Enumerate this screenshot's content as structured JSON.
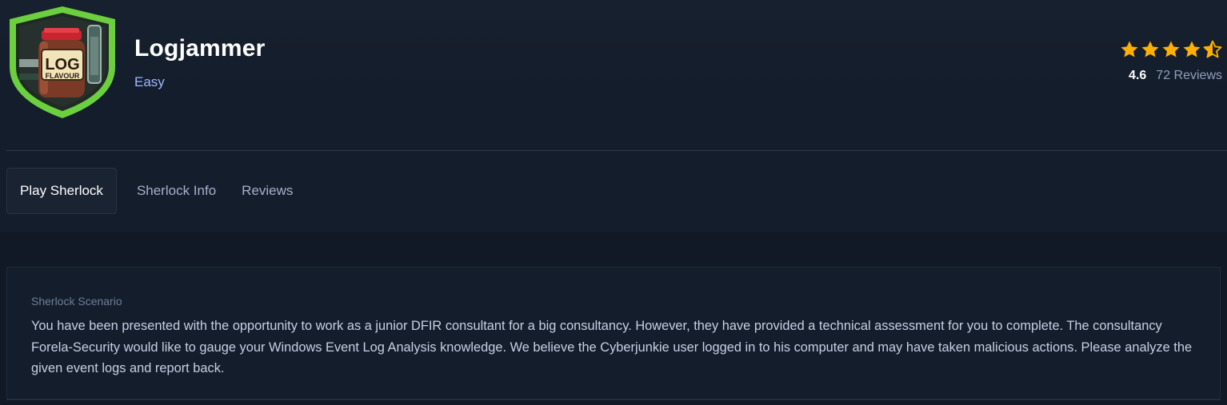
{
  "sherlock": {
    "title": "Logjammer",
    "difficulty": "Easy",
    "badge": {
      "icon": "log-flavour-jar-shield-icon",
      "label_line1": "LOG",
      "label_line2": "FLAVOUR",
      "shield_color": "#6ccf3e",
      "jar_lid_color": "#c9242f"
    }
  },
  "rating": {
    "score": "4.6",
    "reviews_label": "72 Reviews",
    "stars_value": 4.6,
    "stars_max": 5,
    "star_color": "#ffaf00"
  },
  "tabs": [
    {
      "label": "Play Sherlock",
      "active": true
    },
    {
      "label": "Sherlock Info",
      "active": false
    },
    {
      "label": "Reviews",
      "active": false
    }
  ],
  "scenario": {
    "label": "Sherlock Scenario",
    "text": "You have been presented with the opportunity to work as a junior DFIR consultant for a big consultancy. However, they have provided a technical assessment for you to complete. The consultancy Forela-Security would like to gauge your Windows Event Log Analysis knowledge. We believe the Cyberjunkie user logged in to his computer and may have taken malicious actions. Please analyze the given event logs and report back."
  }
}
